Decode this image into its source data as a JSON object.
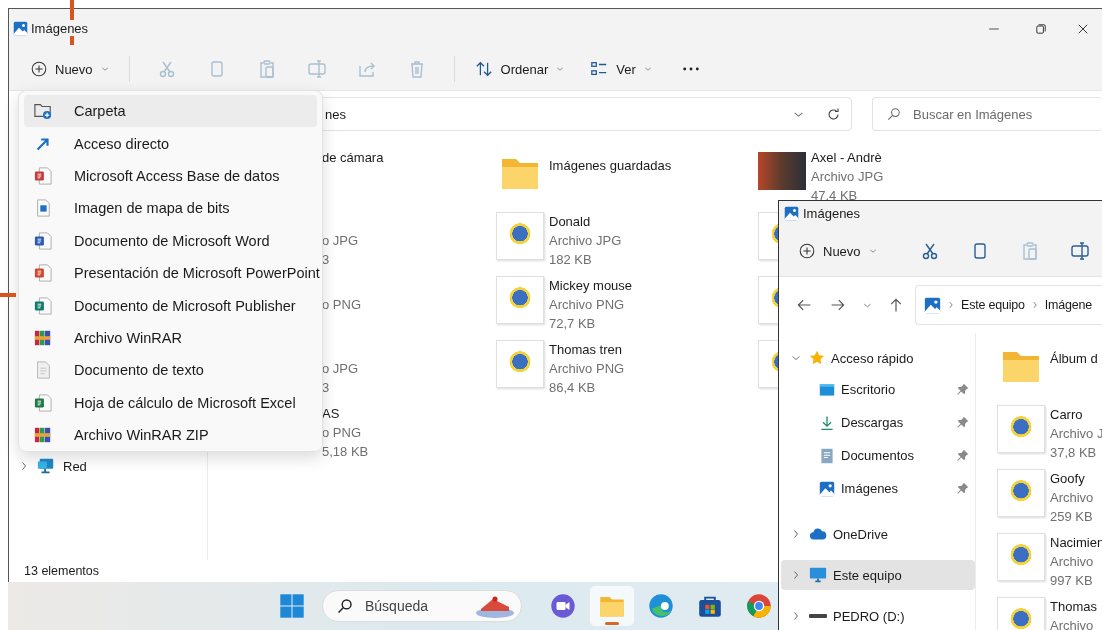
{
  "window": {
    "title": "Imágenes"
  },
  "toolbar": {
    "new_button": {
      "label": "Nuevo"
    },
    "actions": [
      {
        "kind": "cut",
        "disabled": true
      },
      {
        "kind": "copy",
        "disabled": true
      },
      {
        "kind": "paste",
        "disabled": true
      },
      {
        "kind": "rename",
        "disabled": true
      },
      {
        "kind": "share",
        "disabled": true
      },
      {
        "kind": "delete",
        "disabled": true
      }
    ],
    "sort_button": {
      "label": "Ordenar"
    },
    "view_button": {
      "label": "Ver"
    }
  },
  "address_bar": {
    "path": "nes"
  },
  "search": {
    "placeholder": "Buscar en Imágenes"
  },
  "sidebar": {
    "items": [
      {
        "label": "Red",
        "kind": "network",
        "expanded": false,
        "selected": false
      }
    ]
  },
  "files": {
    "rows": [
      [
        {
          "name": "de cámara"
        },
        {
          "kind": "folder",
          "name": "Imágenes guardadas"
        },
        {
          "kind": "photo",
          "name": "Axel - Andrè",
          "type": "Archivo JPG",
          "size": "47,4 KB"
        }
      ],
      [
        {
          "type": "o JPG",
          "size": "3"
        },
        {
          "kind": "image",
          "name": "Donald",
          "type": "Archivo JPG",
          "size": "182 KB"
        },
        {
          "kind": "image"
        }
      ],
      [
        {
          "type": "o PNG"
        },
        {
          "kind": "image",
          "name": "Mickey mouse",
          "type": "Archivo PNG",
          "size": "72,7 KB"
        },
        {
          "kind": "image"
        }
      ],
      [
        {
          "type": "o JPG",
          "size": "3"
        },
        {
          "kind": "image",
          "name": "Thomas tren",
          "type": "Archivo PNG",
          "size": "86,4 KB"
        },
        {
          "kind": "image"
        }
      ],
      [
        {
          "name": "AS",
          "type": "o PNG",
          "size": "5,18 KB"
        }
      ]
    ]
  },
  "status_bar": {
    "count": "13 elementos"
  },
  "new_menu": {
    "items": [
      {
        "label": "Carpeta",
        "kind": "folder",
        "selected": true
      },
      {
        "label": "Acceso directo",
        "kind": "shortcut",
        "selected": false
      },
      {
        "label": "Microsoft Access Base de datos",
        "kind": "access",
        "selected": false
      },
      {
        "label": "Imagen de mapa de bits",
        "kind": "bitmap",
        "selected": false
      },
      {
        "label": "Documento de Microsoft Word",
        "kind": "word",
        "selected": false
      },
      {
        "label": "Presentación de Microsoft PowerPoint",
        "kind": "powerpoint",
        "selected": false
      },
      {
        "label": "Documento de Microsoft Publisher",
        "kind": "publisher",
        "selected": false
      },
      {
        "label": "Archivo WinRAR",
        "kind": "archive",
        "selected": false
      },
      {
        "label": "Documento de texto",
        "kind": "text",
        "selected": false
      },
      {
        "label": "Hoja de cálculo de Microsoft Excel",
        "kind": "excel",
        "selected": false
      },
      {
        "label": "Archivo WinRAR ZIP",
        "kind": "archive",
        "selected": false
      }
    ]
  },
  "second_window": {
    "title": "Imágenes",
    "toolbar": {
      "new_button": {
        "label": "Nuevo"
      },
      "actions": [
        {
          "kind": "cut",
          "disabled": false
        },
        {
          "kind": "copy",
          "disabled": false
        },
        {
          "kind": "paste",
          "disabled": true
        },
        {
          "kind": "rename",
          "disabled": false
        }
      ]
    },
    "breadcrumb": [
      "Este equipo",
      "Imágene"
    ],
    "sidebar": {
      "items": [
        {
          "label": "Acceso rápido",
          "kind": "star",
          "expanded": true,
          "selected": false,
          "children": [
            {
              "label": "Escritorio",
              "kind": "desktop",
              "pinned": true,
              "selected": false
            },
            {
              "label": "Descargas",
              "kind": "download",
              "pinned": true,
              "selected": false
            },
            {
              "label": "Documentos",
              "kind": "document",
              "pinned": true,
              "selected": false
            },
            {
              "label": "Imágenes",
              "kind": "pictures",
              "pinned": true,
              "selected": false
            }
          ]
        },
        {
          "label": "OneDrive",
          "kind": "cloud",
          "expanded": false,
          "selected": false
        },
        {
          "label": "Este equipo",
          "kind": "computer",
          "expanded": false,
          "selected": true
        },
        {
          "label": "PEDRO (D:)",
          "kind": "drive",
          "expanded": false,
          "selected": false
        }
      ]
    },
    "files": [
      {
        "kind": "folder",
        "name": "Álbum d"
      },
      {
        "kind": "image",
        "name": "Carro",
        "type": "Archivo J",
        "size": "37,8 KB"
      },
      {
        "kind": "image",
        "name": "Goofy",
        "type": "Archivo",
        "size": "259 KB"
      },
      {
        "kind": "image",
        "name": "Nacimien",
        "type": "Archivo",
        "size": "997 KB"
      },
      {
        "kind": "image",
        "name": "Thomas",
        "type": "Archivo"
      }
    ]
  },
  "taskbar": {
    "search": {
      "placeholder": "Búsqueda"
    },
    "apps": [
      {
        "kind": "chat",
        "active": false
      },
      {
        "kind": "explorer",
        "active": true
      },
      {
        "kind": "edge",
        "active": false
      },
      {
        "kind": "store",
        "active": false
      },
      {
        "kind": "browser",
        "active": false
      }
    ]
  }
}
